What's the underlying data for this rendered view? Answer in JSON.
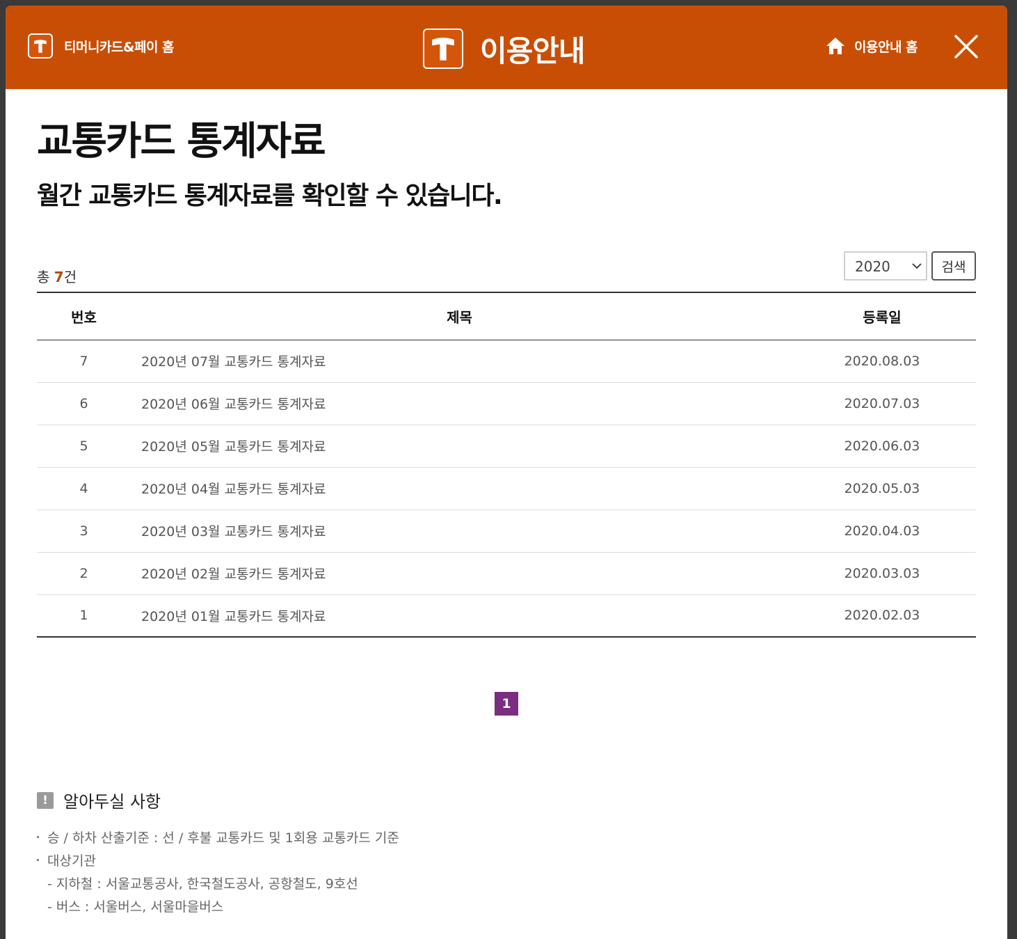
{
  "header": {
    "home_label": "티머니카드&페이 홈",
    "title": "이용안내",
    "guide_home_label": "이용안내 홈",
    "accent": "#c94e05"
  },
  "page": {
    "title": "교통카드 통계자료",
    "subtitle": "월간 교통카드 통계자료를 확인할 수 있습니다."
  },
  "filter": {
    "total_prefix": "총 ",
    "total_count": "7",
    "total_suffix": "건",
    "year": "2020",
    "search_label": "검색"
  },
  "table": {
    "headers": [
      "번호",
      "제목",
      "등록일"
    ],
    "rows": [
      {
        "no": "7",
        "title": "2020년 07월 교통카드 통계자료",
        "date": "2020.08.03"
      },
      {
        "no": "6",
        "title": "2020년 06월 교통카드 통계자료",
        "date": "2020.07.03"
      },
      {
        "no": "5",
        "title": "2020년 05월 교통카드 통계자료",
        "date": "2020.06.03"
      },
      {
        "no": "4",
        "title": "2020년 04월 교통카드 통계자료",
        "date": "2020.05.03"
      },
      {
        "no": "3",
        "title": "2020년 03월 교통카드 통계자료",
        "date": "2020.04.03"
      },
      {
        "no": "2",
        "title": "2020년 02월 교통카드 통계자료",
        "date": "2020.03.03"
      },
      {
        "no": "1",
        "title": "2020년 01월 교통카드 통계자료",
        "date": "2020.02.03"
      }
    ]
  },
  "pagination": {
    "current": "1",
    "active_color": "#7b2d7f"
  },
  "notice": {
    "icon": "exclamation-icon",
    "icon_glyph": "!",
    "title": "알아두실 사항",
    "items": [
      "승 / 하차 산출기준 : 선 / 후불 교통카드 및 1회용 교통카드 기준",
      "대상기관"
    ],
    "sub_items": [
      "- 지하철 : 서울교통공사, 한국철도공사, 공항철도, 9호선",
      "- 버스 : 서울버스, 서울마을버스"
    ]
  }
}
